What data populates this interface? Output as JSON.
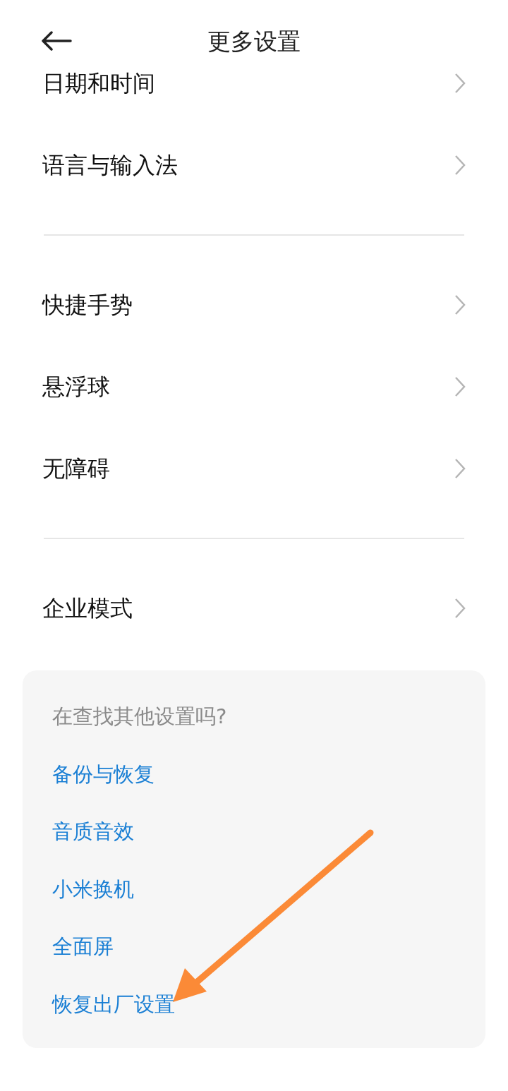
{
  "header": {
    "title": "更多设置"
  },
  "groups": [
    {
      "items": [
        {
          "label": "日期和时间"
        },
        {
          "label": "语言与输入法"
        }
      ]
    },
    {
      "items": [
        {
          "label": "快捷手势"
        },
        {
          "label": "悬浮球"
        },
        {
          "label": "无障碍"
        }
      ]
    },
    {
      "items": [
        {
          "label": "企业模式"
        }
      ]
    }
  ],
  "suggestions": {
    "question": "在查找其他设置吗?",
    "links": [
      "备份与恢复",
      "音质音效",
      "小米换机",
      "全面屏",
      "恢复出厂设置"
    ]
  }
}
